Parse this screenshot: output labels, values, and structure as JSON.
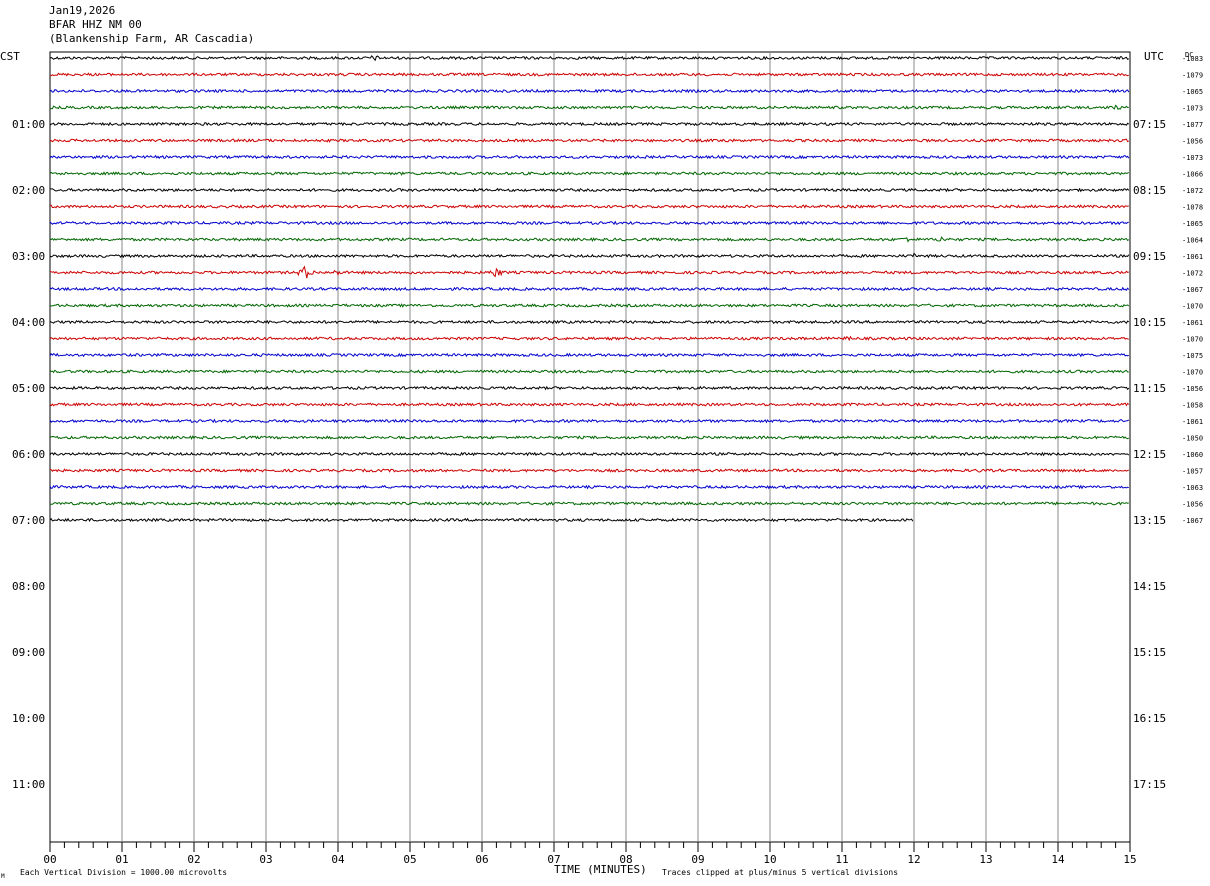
{
  "header": {
    "date": "Jan19,2026",
    "station": "BFAR HHZ NM 00",
    "location": "(Blankenship Farm, AR Cascadia)"
  },
  "left_tz": "CST",
  "right_tz": "UTC",
  "dc_label": "DC",
  "footer": {
    "scale": "Each Vertical Division = 1000.00 microvolts",
    "xlabel": "TIME (MINUTES)",
    "clip": "Traces clipped at plus/minus 5 vertical divisions",
    "corner": "M"
  },
  "colors": [
    "#000000",
    "#cc0000",
    "#0000cc",
    "#006600"
  ],
  "chart_data": {
    "type": "line",
    "title": "BFAR HHZ NM 00",
    "xlabel": "TIME (MINUTES)",
    "xlim": [
      0,
      15
    ],
    "x_ticks": [
      "00",
      "01",
      "02",
      "03",
      "04",
      "05",
      "06",
      "07",
      "08",
      "09",
      "10",
      "11",
      "12",
      "13",
      "14",
      "15"
    ],
    "row_minutes": 15,
    "rows_total": 48,
    "hour_labels_left": [
      "",
      "01:00",
      "02:00",
      "03:00",
      "04:00",
      "05:00",
      "06:00",
      "07:00",
      "08:00",
      "09:00",
      "10:00",
      "11:00"
    ],
    "hour_labels_right": [
      "",
      "07:15",
      "08:15",
      "09:15",
      "10:15",
      "11:15",
      "12:15",
      "13:15",
      "14:15",
      "15:15",
      "16:15",
      "17:15"
    ],
    "dc_offsets": [
      "-1083",
      "-1079",
      "-1065",
      "-1073",
      "-1077",
      "-1056",
      "-1073",
      "-1066",
      "-1072",
      "-1078",
      "-1065",
      "-1064",
      "-1061",
      "-1072",
      "-1067",
      "-1070",
      "-1061",
      "-1070",
      "-1075",
      "-1070",
      "-1056",
      "-1058",
      "-1061",
      "-1050",
      "-1060",
      "-1057",
      "-1063",
      "-1056",
      "-1067"
    ],
    "traces": [
      {
        "row": 0,
        "end": 15,
        "events": [
          [
            4.5,
            3
          ]
        ]
      },
      {
        "row": 1,
        "end": 15,
        "events": []
      },
      {
        "row": 2,
        "end": 15,
        "events": []
      },
      {
        "row": 3,
        "end": 15,
        "events": [
          [
            14.8,
            2.5
          ]
        ]
      },
      {
        "row": 4,
        "end": 15,
        "events": []
      },
      {
        "row": 5,
        "end": 15,
        "events": [
          [
            9.4,
            2.5
          ],
          [
            12.4,
            2.5
          ]
        ]
      },
      {
        "row": 6,
        "end": 15,
        "events": []
      },
      {
        "row": 7,
        "end": 15,
        "events": []
      },
      {
        "row": 8,
        "end": 15,
        "events": []
      },
      {
        "row": 9,
        "end": 15,
        "events": []
      },
      {
        "row": 10,
        "end": 15,
        "events": []
      },
      {
        "row": 11,
        "end": 15,
        "events": [
          [
            11.9,
            3
          ],
          [
            12.4,
            3.5
          ]
        ]
      },
      {
        "row": 12,
        "end": 15,
        "events": [
          [
            12.0,
            2.5
          ]
        ]
      },
      {
        "row": 13,
        "end": 15,
        "events": [
          [
            3.55,
            7
          ],
          [
            4.0,
            3
          ],
          [
            6.2,
            5
          ]
        ]
      },
      {
        "row": 14,
        "end": 15,
        "events": []
      },
      {
        "row": 15,
        "end": 15,
        "events": []
      },
      {
        "row": 16,
        "end": 15,
        "events": []
      },
      {
        "row": 17,
        "end": 15,
        "events": [
          [
            11.1,
            2.5
          ]
        ]
      },
      {
        "row": 18,
        "end": 15,
        "events": []
      },
      {
        "row": 19,
        "end": 15,
        "events": []
      },
      {
        "row": 20,
        "end": 15,
        "events": []
      },
      {
        "row": 21,
        "end": 15,
        "events": []
      },
      {
        "row": 22,
        "end": 15,
        "events": []
      },
      {
        "row": 23,
        "end": 15,
        "events": []
      },
      {
        "row": 24,
        "end": 15,
        "events": []
      },
      {
        "row": 25,
        "end": 15,
        "events": [
          [
            12.9,
            2
          ]
        ]
      },
      {
        "row": 26,
        "end": 15,
        "events": []
      },
      {
        "row": 27,
        "end": 15,
        "events": []
      },
      {
        "row": 28,
        "end": 12,
        "events": [
          [
            10.9,
            2
          ]
        ]
      }
    ]
  }
}
